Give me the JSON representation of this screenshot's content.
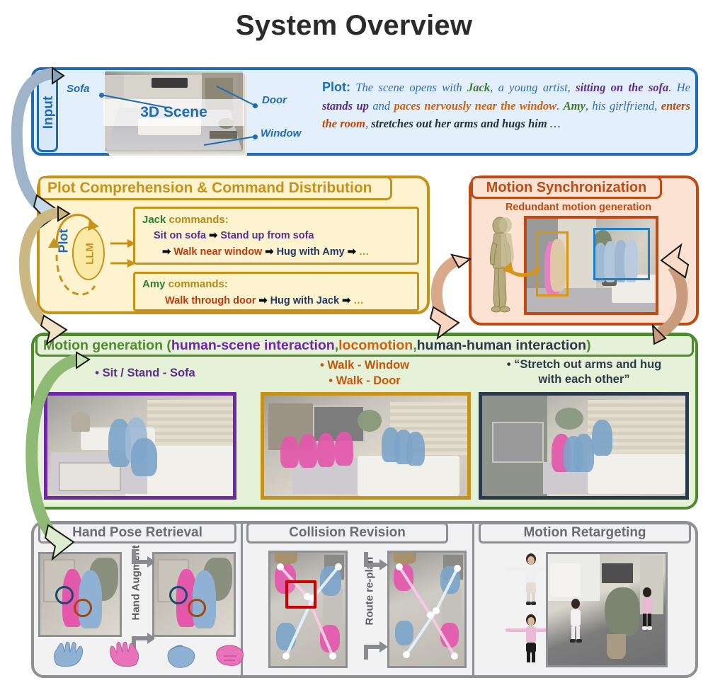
{
  "title": "System Overview",
  "input": {
    "tab_label": "Input",
    "scene_label": "3D Scene",
    "annotations": [
      "Sofa",
      "Door",
      "Window"
    ],
    "plot_label": "Plot:",
    "plot_segments": [
      {
        "text": "The scene opens with ",
        "color": "blue"
      },
      {
        "text": "Jack",
        "color": "green"
      },
      {
        "text": ", a young artist, ",
        "color": "blue"
      },
      {
        "text": "sitting on the sofa",
        "color": "purple"
      },
      {
        "text": ". He ",
        "color": "blue"
      },
      {
        "text": "stands up",
        "color": "purple"
      },
      {
        "text": " and ",
        "color": "blue"
      },
      {
        "text": "paces nervously near the window",
        "color": "orange"
      },
      {
        "text": ". ",
        "color": "blue"
      },
      {
        "text": "Amy",
        "color": "green"
      },
      {
        "text": ", his girlfriend, ",
        "color": "blue"
      },
      {
        "text": "enters the room",
        "color": "rust"
      },
      {
        "text": ", ",
        "color": "blue"
      },
      {
        "text": "stretches out her arms and hugs him",
        "color": "dark"
      },
      {
        "text": " …",
        "color": "dark"
      }
    ]
  },
  "plot_comprehension": {
    "header": "Plot Comprehension & Command Distribution",
    "plot_word": "Plot",
    "llm_label": "LLM",
    "jack": {
      "name": "Jack",
      "title_rest": " commands:",
      "line1": [
        "Sit on sofa",
        "Stand up from sofa"
      ],
      "line2": [
        "Walk near window",
        "Hug with Amy",
        "…"
      ]
    },
    "amy": {
      "name": "Amy",
      "title_rest": " commands:",
      "line1": [
        "Walk through door",
        "Hug with Jack",
        "…"
      ]
    },
    "arrow_glyph": "➡"
  },
  "motion_sync": {
    "header": "Motion Synchronization",
    "subtitle": "Redundant motion generation"
  },
  "motion_generation": {
    "header_parts": [
      {
        "text": "Motion generation (",
        "color": "green"
      },
      {
        "text": "human-scene interaction",
        "color": "purple"
      },
      {
        "text": ", ",
        "color": "green"
      },
      {
        "text": "locomotion",
        "color": "orange"
      },
      {
        "text": ", ",
        "color": "green"
      },
      {
        "text": "human-human interaction",
        "color": "dark"
      },
      {
        "text": ")",
        "color": "green"
      }
    ],
    "captions": [
      "• Sit / Stand - Sofa",
      "• Walk - Window\n• Walk - Door",
      "• “Stretch out arms and hug\nwith each other”"
    ],
    "caption1": "• Sit / Stand - Sofa",
    "caption2_line1": "• Walk - Window",
    "caption2_line2": "• Walk - Door",
    "caption3_line1": "• “Stretch out arms and hug",
    "caption3_line2": "with each other”"
  },
  "post_processing": {
    "panels": [
      {
        "title": "Hand Pose Retrieval",
        "step_label": "Hand Augment"
      },
      {
        "title": "Collision Revision",
        "step_label": "Route re-plan"
      },
      {
        "title": "Motion Retargeting",
        "step_label": ""
      }
    ],
    "panel1_title": "Hand Pose Retrieval",
    "panel1_step": "Hand Augment",
    "panel2_title": "Collision Revision",
    "panel2_step": "Route re-plan",
    "panel3_title": "Motion Retargeting"
  },
  "colors": {
    "input_border": "#1f6cb4",
    "input_fill": "#e3effa",
    "plot_border": "#c8921a",
    "plot_fill": "#fdf3cf",
    "sync_border": "#c04a14",
    "sync_fill": "#fbe2d2",
    "gen_border": "#4e8a2e",
    "gen_fill": "#e6f2d8",
    "post_border": "#8f9094",
    "post_fill": "#f2f2f2",
    "purple": "#7026a8",
    "orange": "#d2610f",
    "pink_figure": "#e458ab",
    "blue_figure": "#7da5c9"
  }
}
